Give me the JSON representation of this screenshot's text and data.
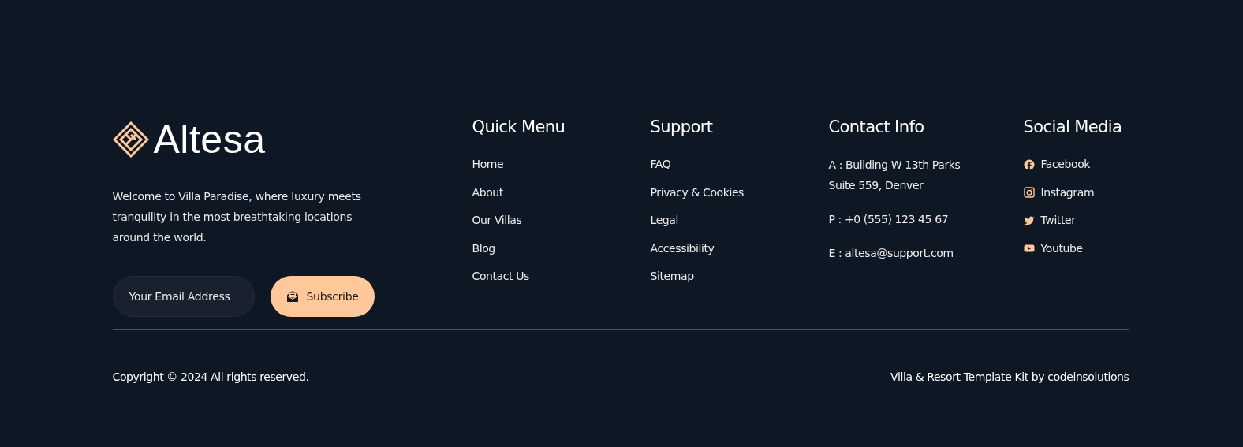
{
  "brand": {
    "name": "Altesa",
    "description": "Welcome to Villa Paradise, where luxury meets tranquility in the most breathtaking locations around the world."
  },
  "newsletter": {
    "placeholder": "Your Email Address",
    "button": "Subscribe"
  },
  "quick_menu": {
    "title": "Quick Menu",
    "links": [
      "Home",
      "About",
      "Our Villas",
      "Blog",
      "Contact Us"
    ]
  },
  "support": {
    "title": "Support",
    "links": [
      "FAQ",
      "Privacy & Cookies",
      "Legal",
      "Accessibility",
      "Sitemap"
    ]
  },
  "contact_info": {
    "title": "Contact Info",
    "entries": [
      {
        "lines": [
          "A : Building W 13th Parks",
          "Suite 559, Denver"
        ]
      },
      {
        "lines": [
          "P : +0 (555) 123 45 67"
        ]
      },
      {
        "lines": [
          "E : altesa@support.com"
        ]
      }
    ]
  },
  "social_media": {
    "title": "Social Media",
    "links": [
      {
        "kind": "facebook",
        "label": "Facebook"
      },
      {
        "kind": "instagram",
        "label": "Instagram"
      },
      {
        "kind": "twitter",
        "label": "Twitter"
      },
      {
        "kind": "youtube",
        "label": "Youtube"
      }
    ]
  },
  "bottom_bar": {
    "copyright": "Copyright © 2024 All rights reserved.",
    "credit": "Villa & Resort Template Kit by codeinsolutions"
  }
}
